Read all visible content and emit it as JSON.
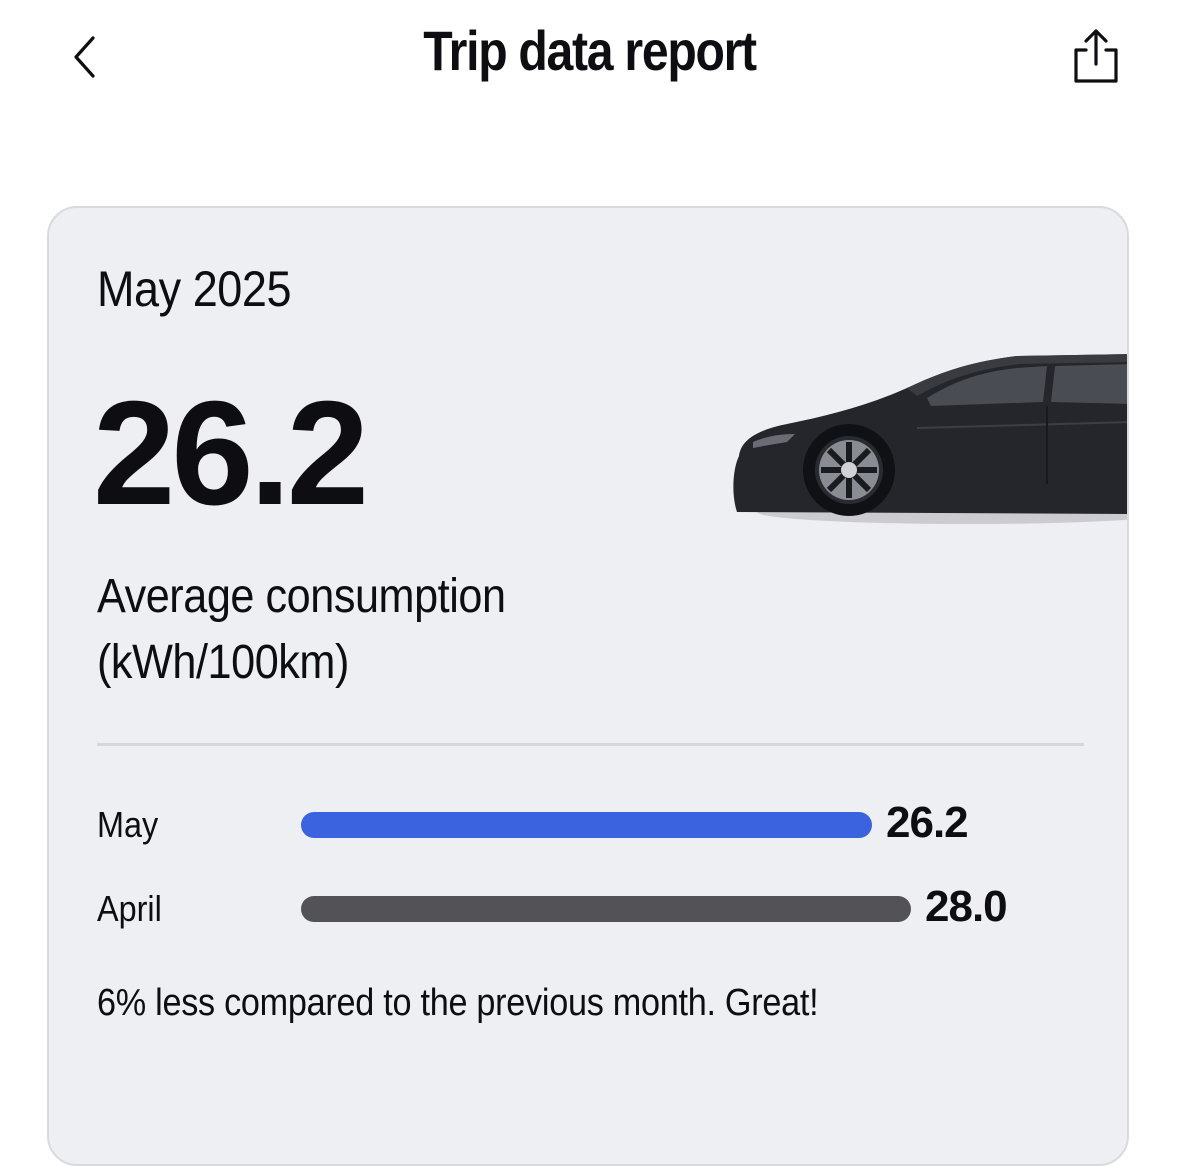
{
  "header": {
    "title": "Trip data report",
    "back_icon": "chevron-left-icon",
    "share_icon": "share-icon"
  },
  "card": {
    "month": "May 2025",
    "value": "26.2",
    "label_line1": "Average consumption",
    "label_line2": "(kWh/100km)",
    "car_image": "car-side-view",
    "comparison": [
      {
        "label": "May",
        "value": "26.2",
        "amount": 26.2,
        "color": "#3b63e0"
      },
      {
        "label": "April",
        "value": "28.0",
        "amount": 28.0,
        "color": "#535357"
      }
    ],
    "summary": "6% less compared to the previous month. Great!"
  }
}
